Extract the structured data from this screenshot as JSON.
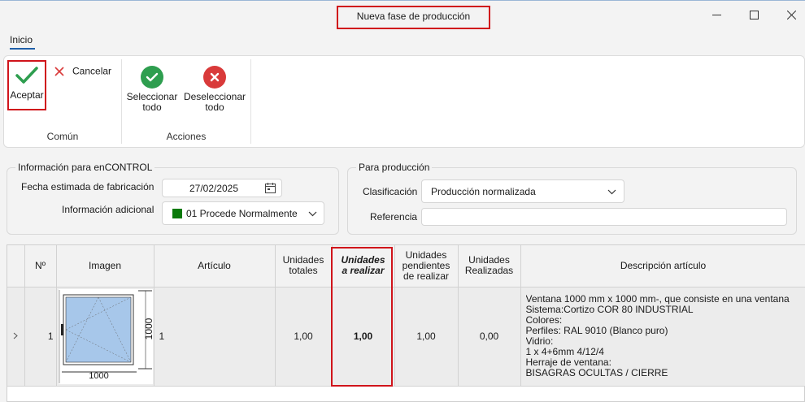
{
  "window": {
    "title": "Nueva fase de producción"
  },
  "ribbon": {
    "tab": "Inicio",
    "groups": {
      "comun": {
        "label": "Común",
        "accept": "Aceptar",
        "cancel": "Cancelar"
      },
      "acciones": {
        "label": "Acciones",
        "select_all_line1": "Seleccionar",
        "select_all_line2": "todo",
        "deselect_all_line1": "Deseleccionar",
        "deselect_all_line2": "todo"
      }
    }
  },
  "encontrol": {
    "legend": "Información para enCONTROL",
    "fecha_label": "Fecha estimada de fabricación",
    "fecha_value": "27/02/2025",
    "info_label": "Información adicional",
    "info_value": "01 Procede Normalmente",
    "info_color": "#0a7a0a"
  },
  "produccion": {
    "legend": "Para producción",
    "clasificacion_label": "Clasificación",
    "clasificacion_value": "Producción normalizada",
    "referencia_label": "Referencia",
    "referencia_value": ""
  },
  "grid": {
    "headers": {
      "n": "Nº",
      "imagen": "Imagen",
      "articulo": "Artículo",
      "unidades_totales_1": "Unidades",
      "unidades_totales_2": "totales",
      "unidades_realizar_1": "Unidades",
      "unidades_realizar_2": "a realizar",
      "unidades_pendientes_1": "Unidades",
      "unidades_pendientes_2": "pendientes",
      "unidades_pendientes_3": "de realizar",
      "unidades_realizadas_1": "Unidades",
      "unidades_realizadas_2": "Realizadas",
      "descripcion": "Descripción artículo"
    },
    "rows": [
      {
        "n": "1",
        "image_width_label": "1000",
        "image_height_label": "1000",
        "articulo": "1",
        "unidades_totales": "1,00",
        "unidades_realizar": "1,00",
        "unidades_pendientes": "1,00",
        "unidades_realizadas": "0,00",
        "descripcion": [
          "Ventana 1000 mm x 1000 mm-, que consiste en una ventana",
          "Sistema:Cortizo COR 80 INDUSTRIAL",
          "Colores:",
          "Perfiles: RAL 9010 (Blanco puro)",
          "Vidrio:",
          "1 x 4+6mm 4/12/4",
          "Herraje de ventana:",
          "BISAGRAS OCULTAS / CIERRE"
        ]
      }
    ]
  },
  "colors": {
    "accept_green": "#2e9e4f",
    "cancel_red": "#d93a3a",
    "highlight_red": "#d0141b",
    "tab_blue": "#1f5fa8",
    "glass_blue": "#a7c7ea"
  }
}
